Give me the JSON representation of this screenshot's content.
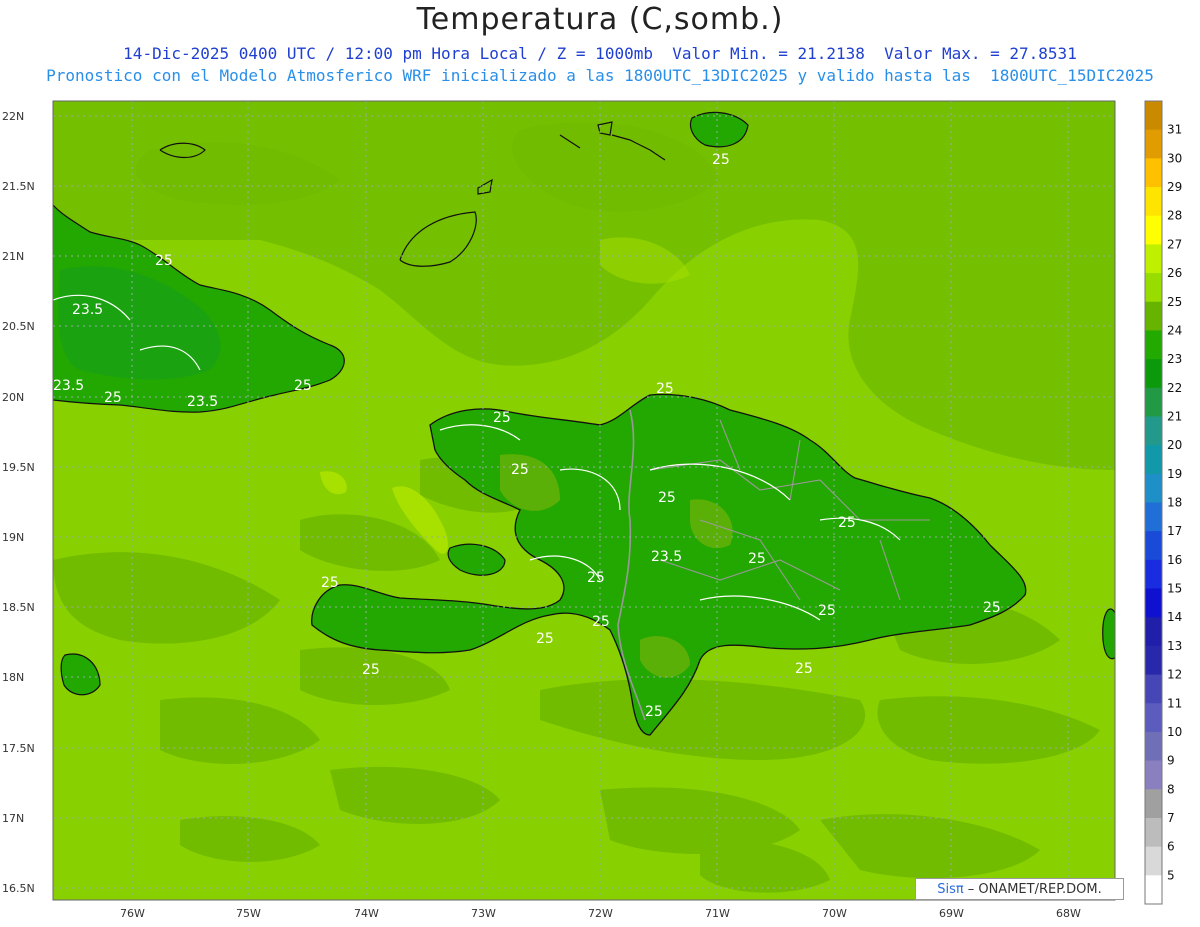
{
  "title": "Temperatura (C,somb.)",
  "subtitle_line1": "14-Dic-2025 0400 UTC / 12:00 pm Hora Local / Z = 1000mb  Valor Min. = 21.2138  Valor Max. = 27.8531",
  "subtitle_line2": "Pronostico con el Modelo Atmosferico WRF inicializado a las 1800UTC_13DIC2025 y valido hasta las  1800UTC_15DIC2025",
  "credit": {
    "logo": "Sisπ",
    "text": "– ONAMET/REP.DOM."
  },
  "axes": {
    "lat_labels": [
      "22N",
      "21.5N",
      "21N",
      "20.5N",
      "20N",
      "19.5N",
      "19N",
      "18.5N",
      "18N",
      "17.5N",
      "17N",
      "16.5N"
    ],
    "lon_labels": [
      "76W",
      "75W",
      "74W",
      "73W",
      "72W",
      "71W",
      "70W",
      "69W",
      "68W"
    ]
  },
  "colorbar": {
    "labels": [
      "31",
      "30",
      "29",
      "28",
      "27",
      "26",
      "25",
      "24",
      "23",
      "22",
      "21",
      "20",
      "19",
      "18",
      "17",
      "16",
      "15",
      "14",
      "13",
      "12",
      "11",
      "10",
      "9",
      "8",
      "7",
      "6",
      "5"
    ],
    "colors": [
      "#c98a00",
      "#e09c00",
      "#ffc000",
      "#ffe400",
      "#ffff00",
      "#bff000",
      "#99dd00",
      "#66b300",
      "#22aa00",
      "#0c9a0c",
      "#229944",
      "#22998a",
      "#1199aa",
      "#1f8fc8",
      "#1f6fd6",
      "#1a4ad8",
      "#1a2ce0",
      "#1010d0",
      "#1f1faa",
      "#2828aa",
      "#4646b6",
      "#5c5cbe",
      "#6f6fb8",
      "#8a80c0",
      "#a0a0a0",
      "#bcbcbc",
      "#d9d9d9",
      "#ffffff"
    ]
  },
  "contour_labels": [
    {
      "text": "25"
    },
    {
      "text": "23.5"
    },
    {
      "text": "23.5"
    },
    {
      "text": "25"
    },
    {
      "text": "23.5"
    },
    {
      "text": "25"
    },
    {
      "text": "25"
    },
    {
      "text": "25"
    },
    {
      "text": "25"
    },
    {
      "text": "25"
    },
    {
      "text": "23.5"
    },
    {
      "text": "25"
    },
    {
      "text": "25"
    },
    {
      "text": "25"
    },
    {
      "text": "25"
    },
    {
      "text": "25"
    },
    {
      "text": "25"
    },
    {
      "text": "25"
    },
    {
      "text": "25"
    },
    {
      "text": "25"
    },
    {
      "text": "25"
    },
    {
      "text": "25"
    },
    {
      "text": "25"
    }
  ],
  "colors": {
    "sea_bg": "#88d000",
    "cool_band": "#6eb800",
    "land": "#22a800",
    "land_warm": "#6ab20a"
  }
}
